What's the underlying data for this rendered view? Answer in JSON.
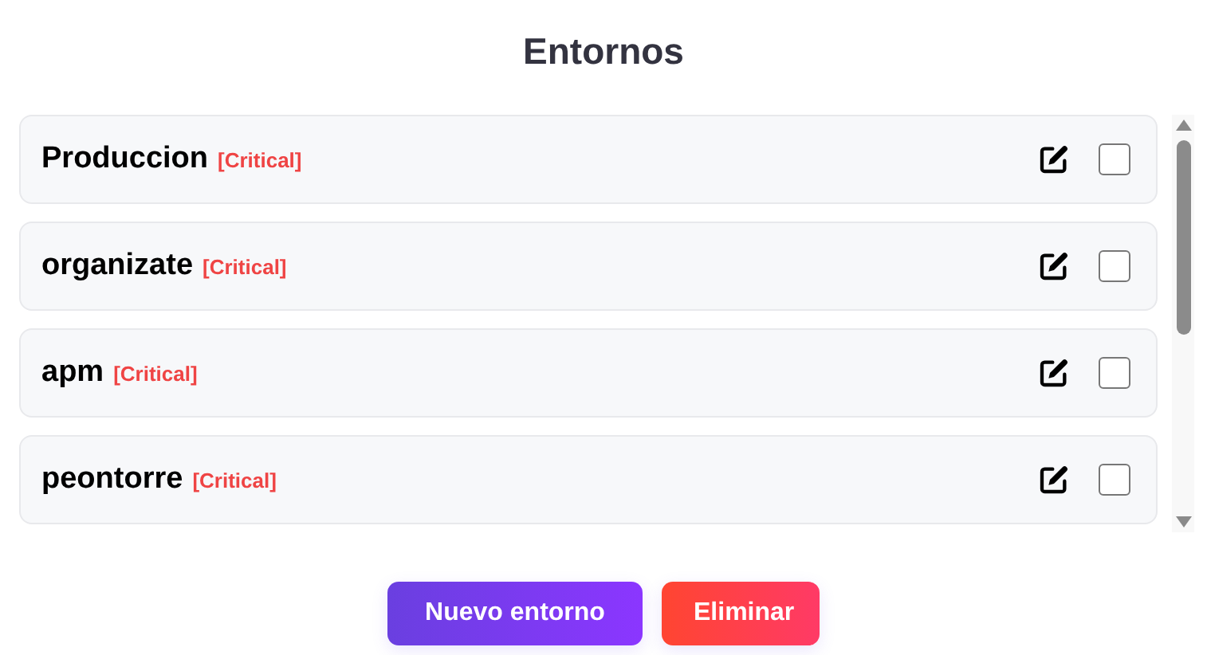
{
  "title": "Entornos",
  "environments": [
    {
      "name": "Produccion",
      "tag": "[Critical]",
      "checked": false
    },
    {
      "name": "organizate",
      "tag": "[Critical]",
      "checked": false
    },
    {
      "name": "apm",
      "tag": "[Critical]",
      "checked": false
    },
    {
      "name": "peontorre",
      "tag": "[Critical]",
      "checked": false
    }
  ],
  "buttons": [
    {
      "label": "Nuevo entorno",
      "kind": "primary"
    },
    {
      "label": "Eliminar",
      "kind": "danger"
    }
  ]
}
